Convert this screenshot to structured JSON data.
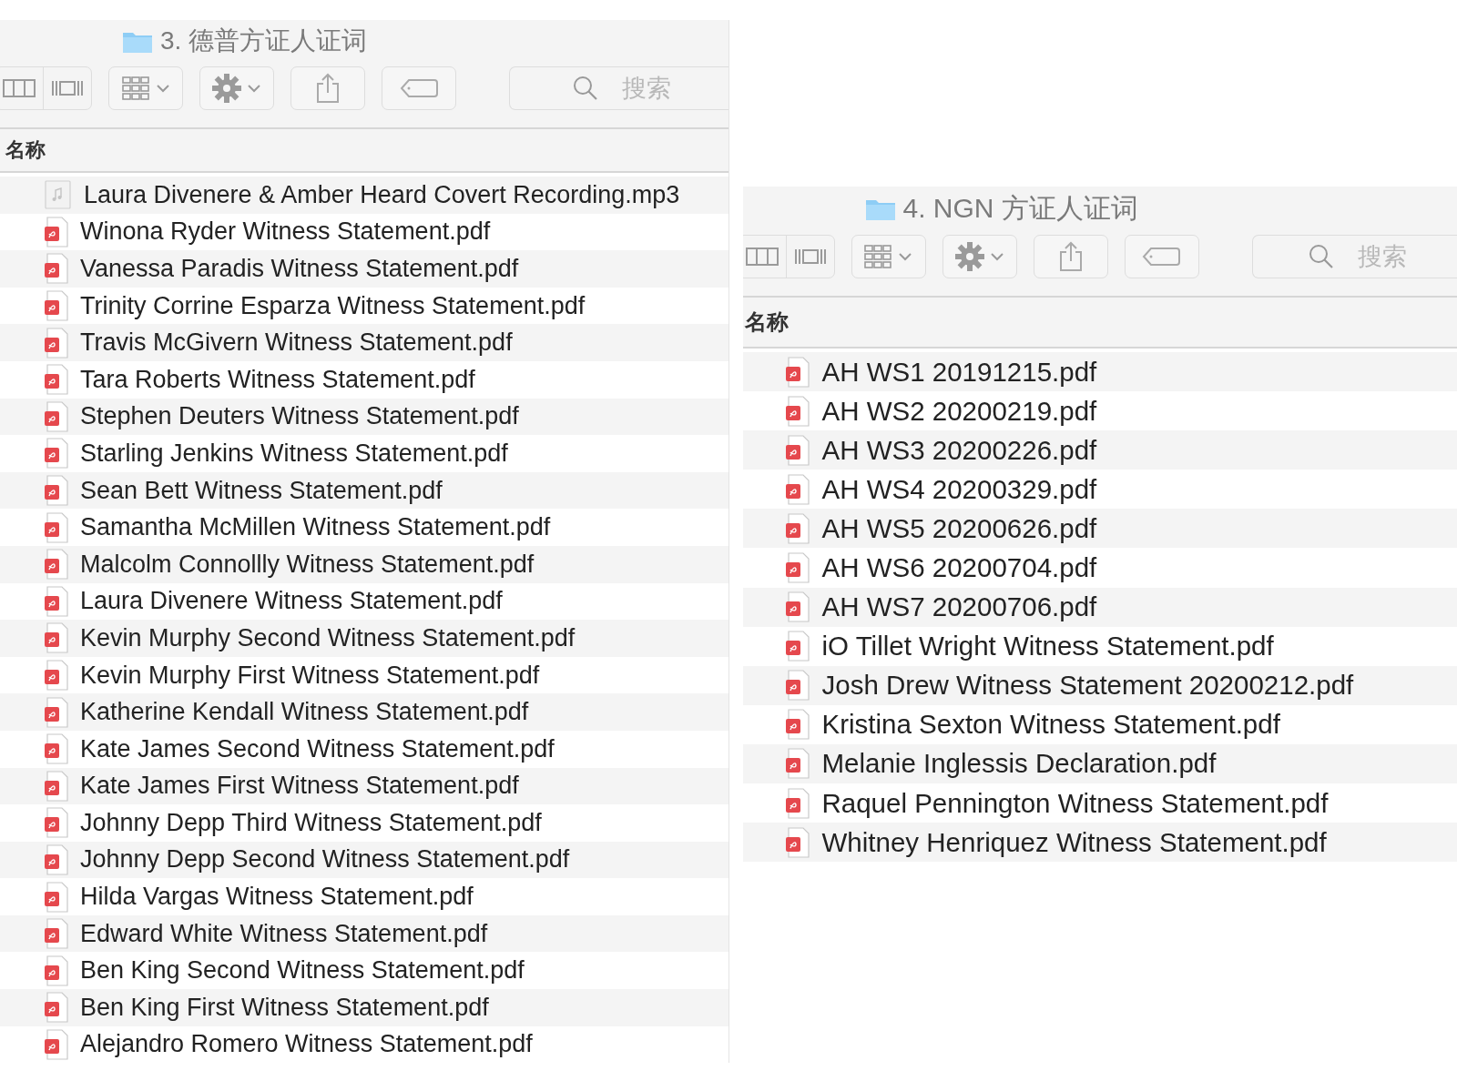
{
  "windows": [
    {
      "title": "3. 德普方证人证词",
      "search": {
        "placeholder": "搜索"
      },
      "column_header": "名称",
      "files": [
        {
          "name": "Laura Divenere & Amber Heard Covert Recording.mp3",
          "kind": "audio"
        },
        {
          "name": "Winona Ryder Witness Statement.pdf",
          "kind": "pdf"
        },
        {
          "name": "Vanessa Paradis Witness Statement.pdf",
          "kind": "pdf"
        },
        {
          "name": "Trinity Corrine Esparza Witness Statement.pdf",
          "kind": "pdf"
        },
        {
          "name": "Travis McGivern Witness Statement.pdf",
          "kind": "pdf"
        },
        {
          "name": "Tara Roberts Witness Statement.pdf",
          "kind": "pdf"
        },
        {
          "name": "Stephen Deuters Witness Statement.pdf",
          "kind": "pdf"
        },
        {
          "name": "Starling Jenkins Witness Statement.pdf",
          "kind": "pdf"
        },
        {
          "name": "Sean Bett Witness Statement.pdf",
          "kind": "pdf"
        },
        {
          "name": "Samantha McMillen Witness Statement.pdf",
          "kind": "pdf"
        },
        {
          "name": "Malcolm Connollly Witness Statement.pdf",
          "kind": "pdf"
        },
        {
          "name": "Laura Divenere Witness Statement.pdf",
          "kind": "pdf"
        },
        {
          "name": "Kevin Murphy Second Witness Statement.pdf",
          "kind": "pdf"
        },
        {
          "name": "Kevin Murphy First Witness Statement.pdf",
          "kind": "pdf"
        },
        {
          "name": "Katherine Kendall Witness Statement.pdf",
          "kind": "pdf"
        },
        {
          "name": "Kate James Second Witness Statement.pdf",
          "kind": "pdf"
        },
        {
          "name": "Kate James First Witness Statement.pdf",
          "kind": "pdf"
        },
        {
          "name": "Johnny Depp Third Witness Statement.pdf",
          "kind": "pdf"
        },
        {
          "name": "Johnny Depp Second Witness Statement.pdf",
          "kind": "pdf"
        },
        {
          "name": "Hilda Vargas Witness Statement.pdf",
          "kind": "pdf"
        },
        {
          "name": "Edward White Witness Statement.pdf",
          "kind": "pdf"
        },
        {
          "name": "Ben King Second Witness Statement.pdf",
          "kind": "pdf"
        },
        {
          "name": "Ben King First Witness Statement.pdf",
          "kind": "pdf"
        },
        {
          "name": "Alejandro Romero Witness Statement.pdf",
          "kind": "pdf"
        }
      ]
    },
    {
      "title": "4. NGN 方证人证词",
      "search": {
        "placeholder": "搜索"
      },
      "column_header": "名称",
      "files": [
        {
          "name": "AH WS1 20191215.pdf",
          "kind": "pdf"
        },
        {
          "name": "AH WS2 20200219.pdf",
          "kind": "pdf"
        },
        {
          "name": "AH WS3 20200226.pdf",
          "kind": "pdf"
        },
        {
          "name": "AH WS4 20200329.pdf",
          "kind": "pdf"
        },
        {
          "name": "AH WS5 20200626.pdf",
          "kind": "pdf"
        },
        {
          "name": "AH WS6 20200704.pdf",
          "kind": "pdf"
        },
        {
          "name": "AH WS7 20200706.pdf",
          "kind": "pdf"
        },
        {
          "name": "iO Tillet Wright Witness Statement.pdf",
          "kind": "pdf"
        },
        {
          "name": "Josh Drew Witness Statement 20200212.pdf",
          "kind": "pdf"
        },
        {
          "name": "Kristina Sexton Witness Statement.pdf",
          "kind": "pdf"
        },
        {
          "name": "Melanie Inglessis Declaration.pdf",
          "kind": "pdf"
        },
        {
          "name": "Raquel Pennington Witness Statement.pdf",
          "kind": "pdf"
        },
        {
          "name": "Whitney Henriquez Witness Statement.pdf",
          "kind": "pdf"
        }
      ]
    }
  ]
}
